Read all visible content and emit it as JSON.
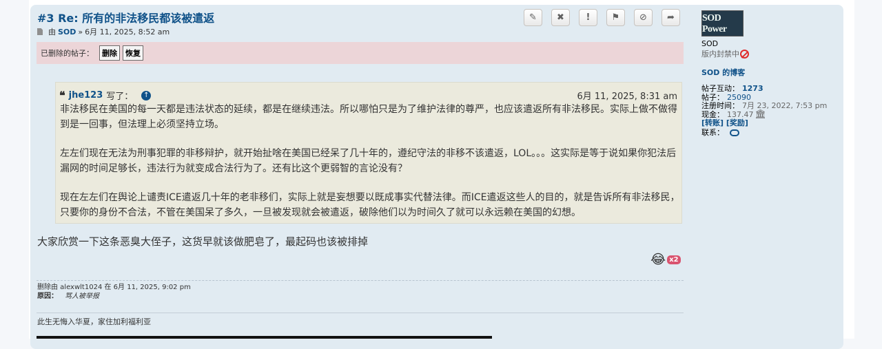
{
  "post": {
    "title": "#3 Re: 所有的非法移民都该被遣返",
    "meta_by": "由",
    "author": "SOD",
    "meta_sep": "»",
    "timestamp": "6月 11, 2025, 8:52 am",
    "actions": [
      {
        "name": "edit",
        "icon": "✎"
      },
      {
        "name": "delete",
        "icon": "✖"
      },
      {
        "name": "report",
        "icon": "!"
      },
      {
        "name": "gift",
        "icon": "⚑"
      },
      {
        "name": "ban",
        "icon": "⊘"
      },
      {
        "name": "quote",
        "icon": "➦"
      }
    ],
    "deleted_bar": {
      "label": "已删除的帖子：",
      "delete_btn": "删除",
      "restore_btn": "恢复"
    },
    "quote": {
      "author": "jhe123",
      "wrote": "写了：",
      "time": "6月 11, 2025, 8:31 am",
      "paragraphs": [
        "非法移民在美国的每一天都是违法状态的延续，都是在继续违法。所以哪怕只是为了维护法律的尊严，也应该遣返所有非法移民。实际上做不做得到是一回事，但法理上必须坚持立场。",
        "左左们现在无法为刑事犯罪的非移辩护，就开始扯啥在美国已经呆了几十年的，遵纪守法的非移不该遣返，LOL。。。这实际是等于说如果你犯法后漏网的时间足够长，违法行为就变成合法行为了。还有比这个更弱智的言论没有？",
        "现在左左们在舆论上谴责ICE遣返几十年的老非移们，实际上就是妄想要以既成事实代替法律。而ICE遣返这些人的目的，就是告诉所有非法移民，只要你的身份不合法，不管在美国呆了多久，一旦被发现就会被遣返，破除他们以为时间久了就可以永远赖在美国的幻想。"
      ]
    },
    "body": "大家欣赏一下这条恶臭大侄子，这货早就该做肥皂了，最起码也该被排掉",
    "reaction_count": "x2",
    "deletion": {
      "line": "删除由 alexwlt1024 在 6月 11, 2025, 9:02 pm",
      "reason_label": "原因：",
      "reason": "骂人被举报"
    },
    "signature": "此生无悔入华夏，家住加利福利亚"
  },
  "profile": {
    "avatar_text": "SOD Power",
    "name": "SOD",
    "rank": "版内封禁中",
    "blog": "SOD 的博客",
    "stats": {
      "interactions_label": "帖子互动：",
      "interactions": "1273",
      "posts_label": "帖子：",
      "posts": "25090",
      "joined_label": "注册时间：",
      "joined": "7月 23, 2022, 7:53 pm",
      "cash_label": "现金：",
      "cash": "137.47",
      "transfer": "[转账]",
      "reward": "[奖励]",
      "contact_label": "联系："
    }
  }
}
